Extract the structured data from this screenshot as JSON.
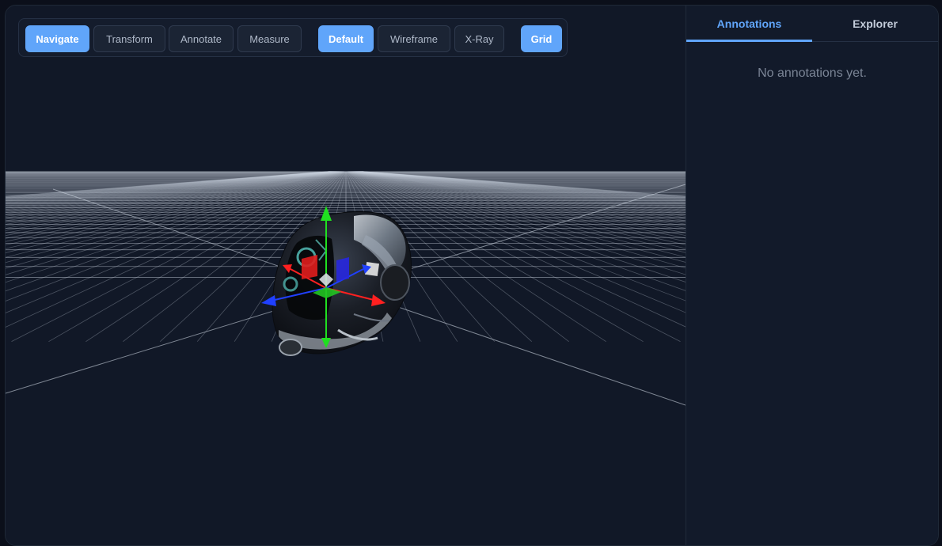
{
  "toolbar": {
    "modes": [
      {
        "label": "Navigate",
        "active": true
      },
      {
        "label": "Transform",
        "active": false
      },
      {
        "label": "Annotate",
        "active": false
      },
      {
        "label": "Measure",
        "active": false
      }
    ],
    "render_styles": [
      {
        "label": "Default",
        "active": true
      },
      {
        "label": "Wireframe",
        "active": false
      },
      {
        "label": "X-Ray",
        "active": false
      }
    ],
    "grid": {
      "label": "Grid",
      "active": true
    }
  },
  "panel": {
    "tabs": [
      {
        "label": "Annotations",
        "active": true
      },
      {
        "label": "Explorer",
        "active": false
      }
    ],
    "empty_message": "No annotations yet."
  },
  "scene": {
    "model": "helmet",
    "gizmo": "translate-gizmo",
    "axis_colors": {
      "x": "#ff2020",
      "y": "#20e020",
      "z": "#2040ff"
    }
  },
  "colors": {
    "accent": "#60a5fa",
    "background": "#111827"
  }
}
